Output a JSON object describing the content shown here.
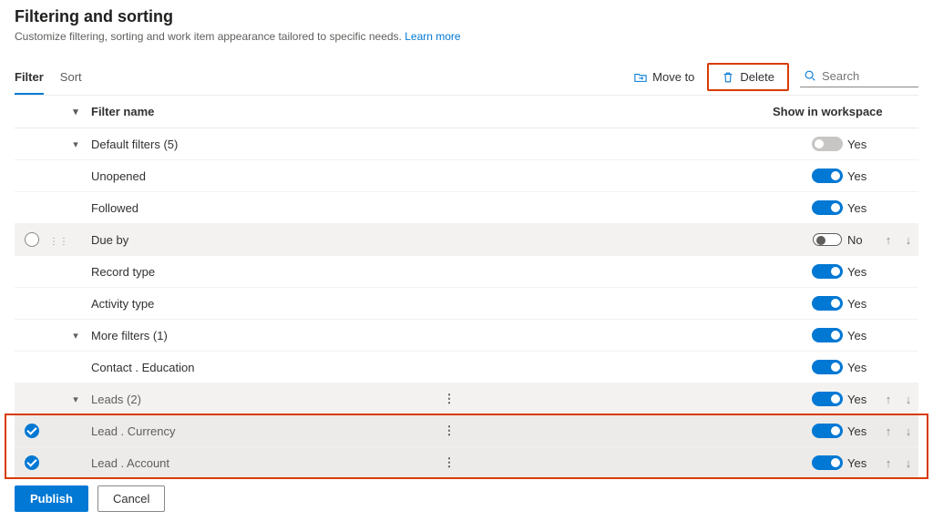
{
  "header": {
    "title": "Filtering and sorting",
    "description": "Customize filtering, sorting and work item appearance tailored to specific needs.",
    "learn_more": "Learn more"
  },
  "tabs": {
    "filter": "Filter",
    "sort": "Sort"
  },
  "toolbar": {
    "move_to": "Move to",
    "delete": "Delete",
    "search_placeholder": "Search"
  },
  "columns": {
    "filter_name": "Filter name",
    "show_in_ws": "Show in workspace"
  },
  "rows": {
    "default_filters": {
      "label": "Default filters (5)",
      "val": "Yes"
    },
    "unopened": {
      "label": "Unopened",
      "val": "Yes"
    },
    "followed": {
      "label": "Followed",
      "val": "Yes"
    },
    "due_by": {
      "label": "Due by",
      "val": "No"
    },
    "record_type": {
      "label": "Record type",
      "val": "Yes"
    },
    "activity_type": {
      "label": "Activity type",
      "val": "Yes"
    },
    "more_filters": {
      "label": "More filters (1)",
      "val": "Yes"
    },
    "contact_edu": {
      "label": "Contact . Education",
      "val": "Yes"
    },
    "leads": {
      "label": "Leads (2)",
      "val": "Yes"
    },
    "lead_currency": {
      "label": "Lead . Currency",
      "val": "Yes"
    },
    "lead_account": {
      "label": "Lead . Account",
      "val": "Yes"
    }
  },
  "footer": {
    "publish": "Publish",
    "cancel": "Cancel"
  }
}
